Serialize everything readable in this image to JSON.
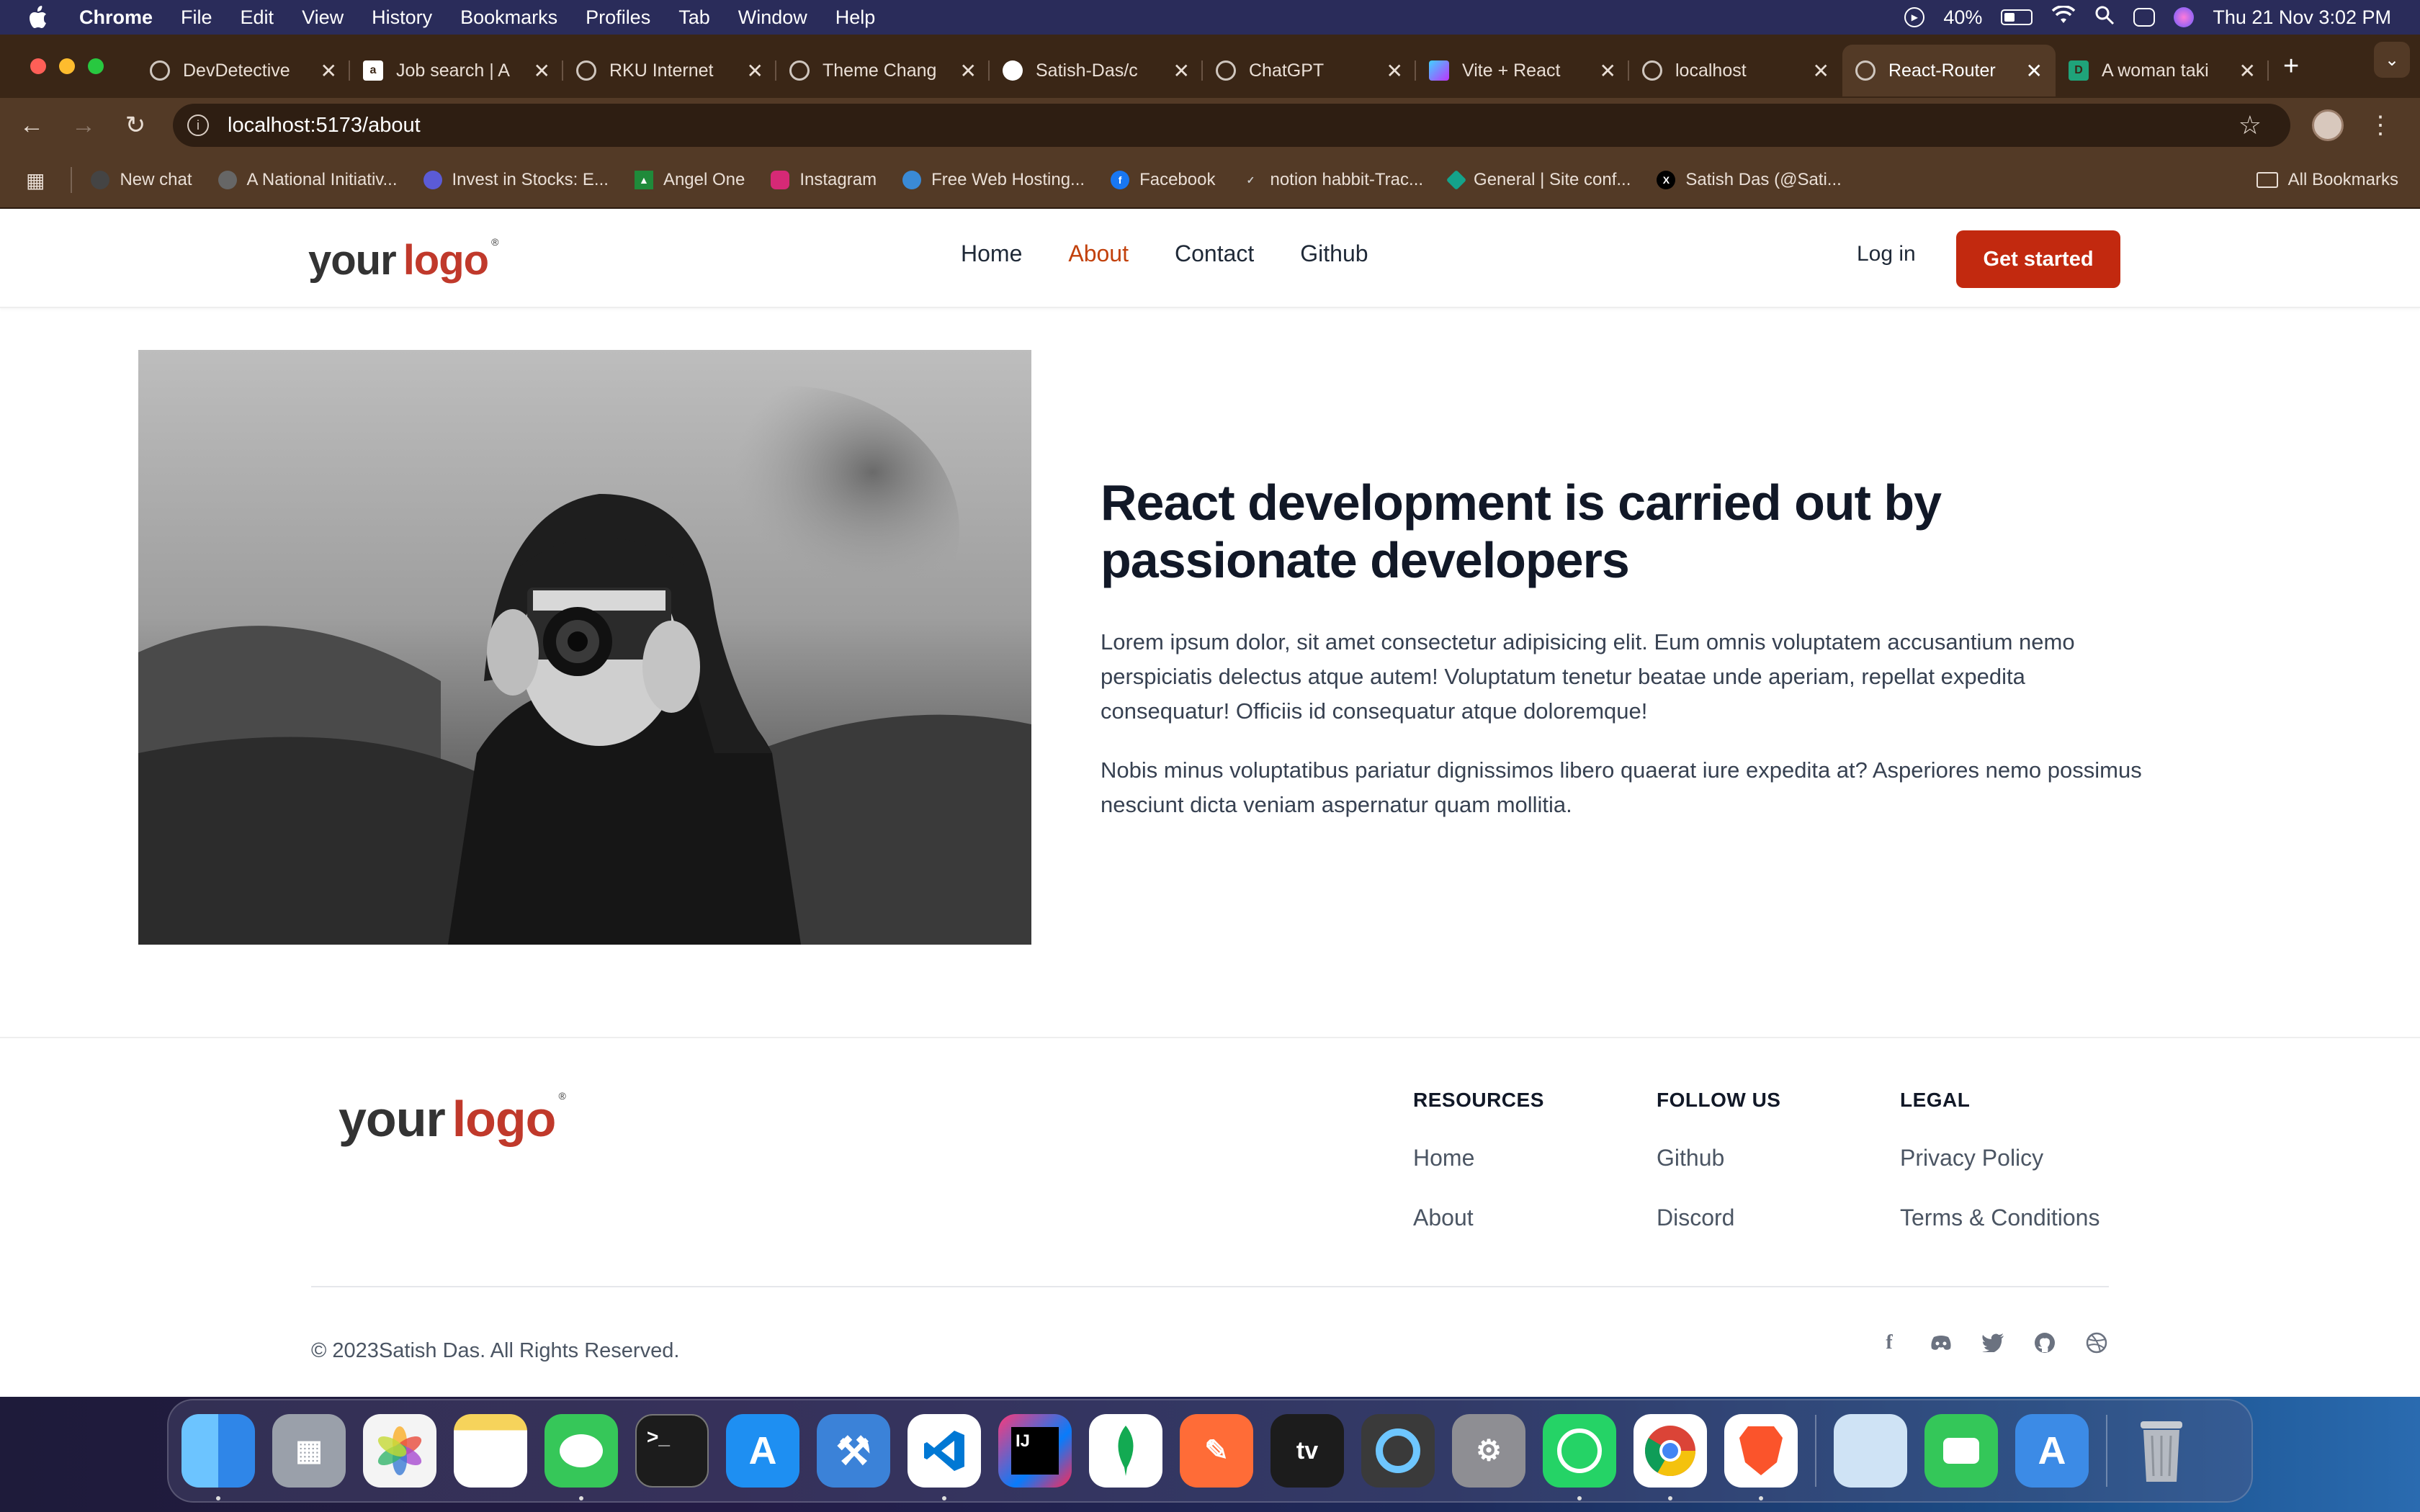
{
  "menubar": {
    "app": "Chrome",
    "items": [
      "File",
      "Edit",
      "View",
      "History",
      "Bookmarks",
      "Profiles",
      "Tab",
      "Window",
      "Help"
    ],
    "battery": "40%",
    "battery_level": 0.4,
    "datetime": "Thu 21 Nov  3:02 PM"
  },
  "tabs": [
    {
      "title": "DevDetective",
      "icon": "globe-icon"
    },
    {
      "title": "Job search | A",
      "icon": "amazon-icon"
    },
    {
      "title": "RKU Internet",
      "icon": "globe-icon"
    },
    {
      "title": "Theme Chang",
      "icon": "globe-icon"
    },
    {
      "title": "Satish-Das/c",
      "icon": "github-icon"
    },
    {
      "title": "ChatGPT",
      "icon": "chatgpt-icon"
    },
    {
      "title": "Vite + React",
      "icon": "vite-icon"
    },
    {
      "title": "localhost",
      "icon": "globe-icon"
    },
    {
      "title": "React-Router",
      "icon": "globe-icon",
      "active": true
    },
    {
      "title": "A woman taki",
      "icon": "doc-icon"
    }
  ],
  "toolbar": {
    "url": "localhost:5173/about"
  },
  "bookmarks": {
    "items": [
      {
        "label": "New chat",
        "color": "#444"
      },
      {
        "label": "A National Initiativ...",
        "color": "#666"
      },
      {
        "label": "Invest in Stocks: E...",
        "color": "#5b5bd6"
      },
      {
        "label": "Angel One",
        "color": "#1f8a3a"
      },
      {
        "label": "Instagram",
        "color": "#d62976"
      },
      {
        "label": "Free Web Hosting...",
        "color": "#3a8ad6"
      },
      {
        "label": "Facebook",
        "color": "#1877f2"
      },
      {
        "label": "notion habbit-Trac...",
        "color": "#555"
      },
      {
        "label": "General | Site conf...",
        "color": "#14a38b"
      },
      {
        "label": "Satish Das (@Sati...",
        "color": "#000"
      }
    ],
    "all": "All Bookmarks"
  },
  "site": {
    "logo_your": "your",
    "logo_logo": "logo",
    "logo_reg": "®",
    "nav": [
      "Home",
      "About",
      "Contact",
      "Github"
    ],
    "active_nav": "About",
    "login": "Log in",
    "cta": "Get started",
    "headline": "React development is carried out by passionate developers",
    "para1": "Lorem ipsum dolor, sit amet consectetur adipisicing elit. Eum omnis voluptatem accusantium nemo perspiciatis delectus atque autem! Voluptatum tenetur beatae unde aperiam, repellat expedita consequatur! Officiis id consequatur atque doloremque!",
    "para2": "Nobis minus voluptatibus pariatur dignissimos libero quaerat iure expedita at? Asperiores nemo possimus nesciunt dicta veniam aspernatur quam mollitia."
  },
  "footer": {
    "resources": {
      "title": "RESOURCES",
      "links": [
        "Home",
        "About"
      ]
    },
    "follow": {
      "title": "FOLLOW US",
      "links": [
        "Github",
        "Discord"
      ]
    },
    "legal": {
      "title": "LEGAL",
      "links": [
        "Privacy Policy",
        "Terms & Conditions"
      ]
    },
    "copyright": "© 2023Satish Das. All Rights Reserved.",
    "social": [
      "facebook-icon",
      "discord-icon",
      "twitter-icon",
      "github-icon",
      "dribbble-icon"
    ]
  },
  "dock": [
    {
      "name": "finder-icon",
      "color": "#2f86e8"
    },
    {
      "name": "launchpad-icon",
      "color": "#9aa0aa"
    },
    {
      "name": "photos-icon",
      "color": "#f4f4f4"
    },
    {
      "name": "notes-icon",
      "color": "#f6d35b"
    },
    {
      "name": "messages-icon",
      "color": "#36c759"
    },
    {
      "name": "terminal-icon",
      "color": "#1c1c1c"
    },
    {
      "name": "app-store-icon",
      "color": "#1e8ff2"
    },
    {
      "name": "xcode-icon",
      "color": "#3b82d8"
    },
    {
      "name": "vscode-icon",
      "color": "#ffffff"
    },
    {
      "name": "intellij-icon",
      "color": "#fc3a7a"
    },
    {
      "name": "mongodb-icon",
      "color": "#ffffff"
    },
    {
      "name": "postman-icon",
      "color": "#ff6c37"
    },
    {
      "name": "apple-tv-icon",
      "color": "#1c1c1c"
    },
    {
      "name": "quicktime-icon",
      "color": "#3a3a3a"
    },
    {
      "name": "system-settings-icon",
      "color": "#8e8e93"
    },
    {
      "name": "whatsapp-icon",
      "color": "#25d366"
    },
    {
      "name": "chrome-icon",
      "color": "#ffffff"
    },
    {
      "name": "brave-icon",
      "color": "#fb542b"
    },
    {
      "name": "preview-icon",
      "color": "#cfe3f5"
    },
    {
      "name": "facetime-icon",
      "color": "#34c759"
    },
    {
      "name": "simulator-icon",
      "color": "#3c8be6"
    },
    {
      "name": "trash-icon",
      "color": "#c8ccd2"
    }
  ]
}
